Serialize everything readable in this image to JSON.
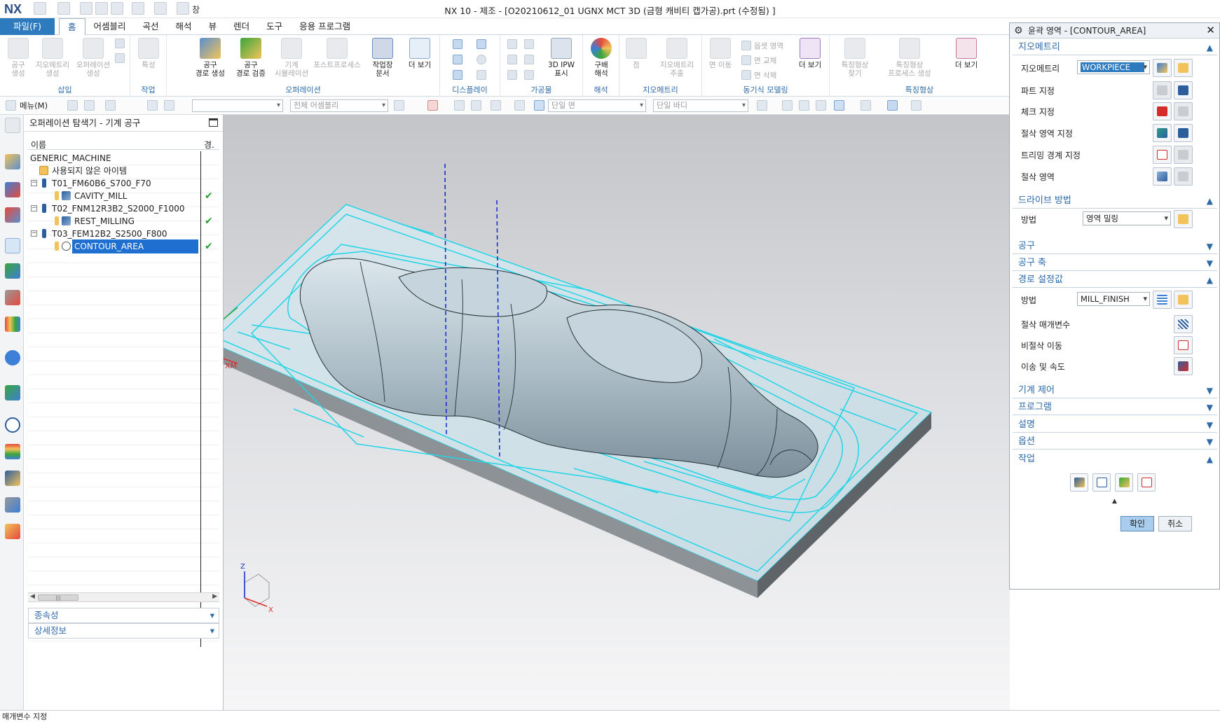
{
  "window": {
    "logo": "NX",
    "title": "NX 10 - 제조 - [O20210612_01 UGNX MCT 3D (금형 캐비티 캡가공).prt (수정됨) ]",
    "qat_window_label": "창"
  },
  "menubar": {
    "file": "파일(F)",
    "tabs": [
      "홈",
      "어셈블리",
      "곡선",
      "해석",
      "뷰",
      "렌더",
      "도구",
      "응용 프로그램"
    ]
  },
  "ribbon": {
    "groups": [
      "삽입",
      "작업",
      "오퍼레이션",
      "디스플레이",
      "가공물",
      "해석",
      "지오메트리",
      "동기식 모델링",
      "특징형상"
    ],
    "buttons": {
      "tool_create": "공구\n생성",
      "geometry_create": "지오메트리\n생성",
      "operation_create": "오퍼레이션\n생성",
      "property": "특성",
      "toolpath_generate": "공구\n경로 생성",
      "toolpath_verify": "공구\n경로 검증",
      "machine_sim": "기계\n시뮬레이션",
      "postprocess": "포스트프로세스",
      "shop_doc": "작업장\n문서",
      "more1": "더 보기",
      "ipw": "3D IPW\n표시",
      "slope": "구배\n해석",
      "point": "점",
      "geo_extract": "지오메트리\n추출",
      "face_move": "면 이동",
      "offset_region": "옵셋 영역",
      "face_replace": "면 교체",
      "face_delete": "면 삭제",
      "more2": "더 보기",
      "feature_find": "특징형상\n찾기",
      "feature_process": "특징형상\n프로세스 생성",
      "more3": "더 보기"
    }
  },
  "toolbar2": {
    "menu": "메뉴(M)",
    "assembly_filter": "전체 어셈블리",
    "single_face": "단일 면",
    "single_body": "단일 바디"
  },
  "navigator": {
    "title": "오퍼레이션 탐색기 - 기계 공구",
    "col_name": "이름",
    "col_status": "경.",
    "rows": [
      {
        "label": "GENERIC_MACHINE",
        "level": 0
      },
      {
        "label": "사용되지 않은 아이템",
        "level": 1
      },
      {
        "label": "T01_FM60B6_S700_F70",
        "level": 1
      },
      {
        "label": "CAVITY_MILL",
        "level": 2
      },
      {
        "label": "T02_FNM12R3B2_S2000_F1000",
        "level": 1
      },
      {
        "label": "REST_MILLING",
        "level": 2
      },
      {
        "label": "T03_FEM12B2_S2500_F800",
        "level": 1
      },
      {
        "label": "CONTOUR_AREA",
        "level": 2
      }
    ],
    "dependencies": "종속성",
    "details": "상세정보"
  },
  "viewport": {
    "axis_ym": "YM",
    "axis_xm": "XM",
    "triad_z": "Z",
    "triad_x": "X"
  },
  "dialog": {
    "title": "윤곽 영역 - [CONTOUR_AREA]",
    "sections": {
      "geometry": "지오메트리",
      "drive": "드라이브 방법",
      "tool": "공구",
      "tool_axis": "공구 축",
      "path_settings": "경로 설정값",
      "machine_control": "기계 제어",
      "program": "프로그램",
      "description": "설명",
      "options": "옵션",
      "actions": "작업"
    },
    "geometry_label": "지오메트리",
    "geometry_value": "WORKPIECE",
    "part": "파트 지정",
    "check": "체크 지정",
    "cut_area_spec": "절삭 영역 지정",
    "trim": "트리밍 경계 지정",
    "cut_area": "절삭 영역",
    "method_label": "방법",
    "drive_value": "영역 밀링",
    "path_method_value": "MILL_FINISH",
    "cut_params": "절삭 매개변수",
    "noncut": "비절삭 이동",
    "feeds": "이송 및 속도",
    "ok": "확인",
    "cancel": "취소"
  },
  "status": "매개변수 지정",
  "colors": {
    "accent": "#2d7abf",
    "toolpath": "#21d5e6",
    "model": "#b9c9d2",
    "selected": "#1f6fd0"
  }
}
